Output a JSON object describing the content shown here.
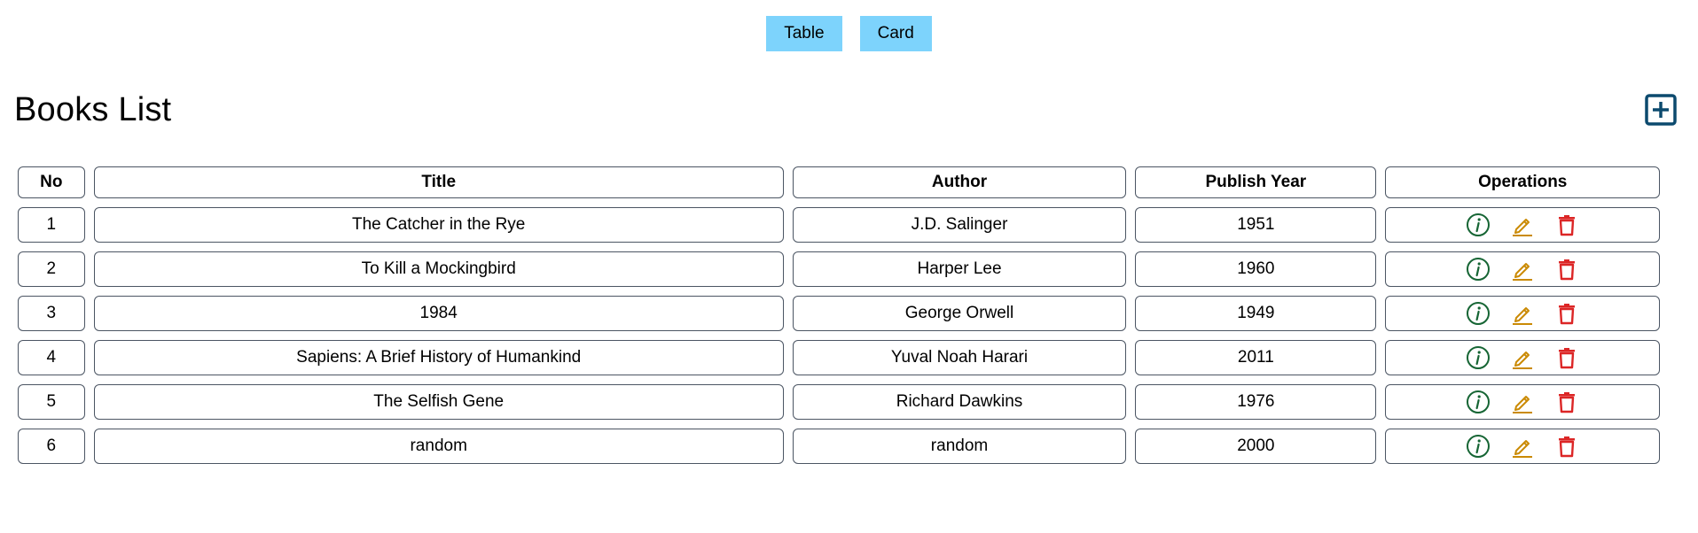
{
  "view_toggle": {
    "table_label": "Table",
    "card_label": "Card"
  },
  "header": {
    "title": "Books List",
    "add_icon": "plus-square-icon"
  },
  "table": {
    "columns": [
      "No",
      "Title",
      "Author",
      "Publish Year",
      "Operations"
    ],
    "rows": [
      {
        "no": "1",
        "title": "The Catcher in the Rye",
        "author": "J.D. Salinger",
        "year": "1951"
      },
      {
        "no": "2",
        "title": "To Kill a Mockingbird",
        "author": "Harper Lee",
        "year": "1960"
      },
      {
        "no": "3",
        "title": "1984",
        "author": "George Orwell",
        "year": "1949"
      },
      {
        "no": "4",
        "title": "Sapiens: A Brief History of Humankind",
        "author": "Yuval Noah Harari",
        "year": "2011"
      },
      {
        "no": "5",
        "title": "The Selfish Gene",
        "author": "Richard Dawkins",
        "year": "1976"
      },
      {
        "no": "6",
        "title": "random",
        "author": "random",
        "year": "2000"
      }
    ],
    "operation_icons": [
      "info-circle-icon",
      "edit-pencil-icon",
      "trash-icon"
    ]
  },
  "colors": {
    "toggle_bg": "#7dd3fc",
    "add_icon": "#0c4a6e",
    "info_icon": "#166534",
    "edit_icon": "#ca8a04",
    "delete_icon": "#dc2626",
    "cell_border": "#4b5563"
  }
}
